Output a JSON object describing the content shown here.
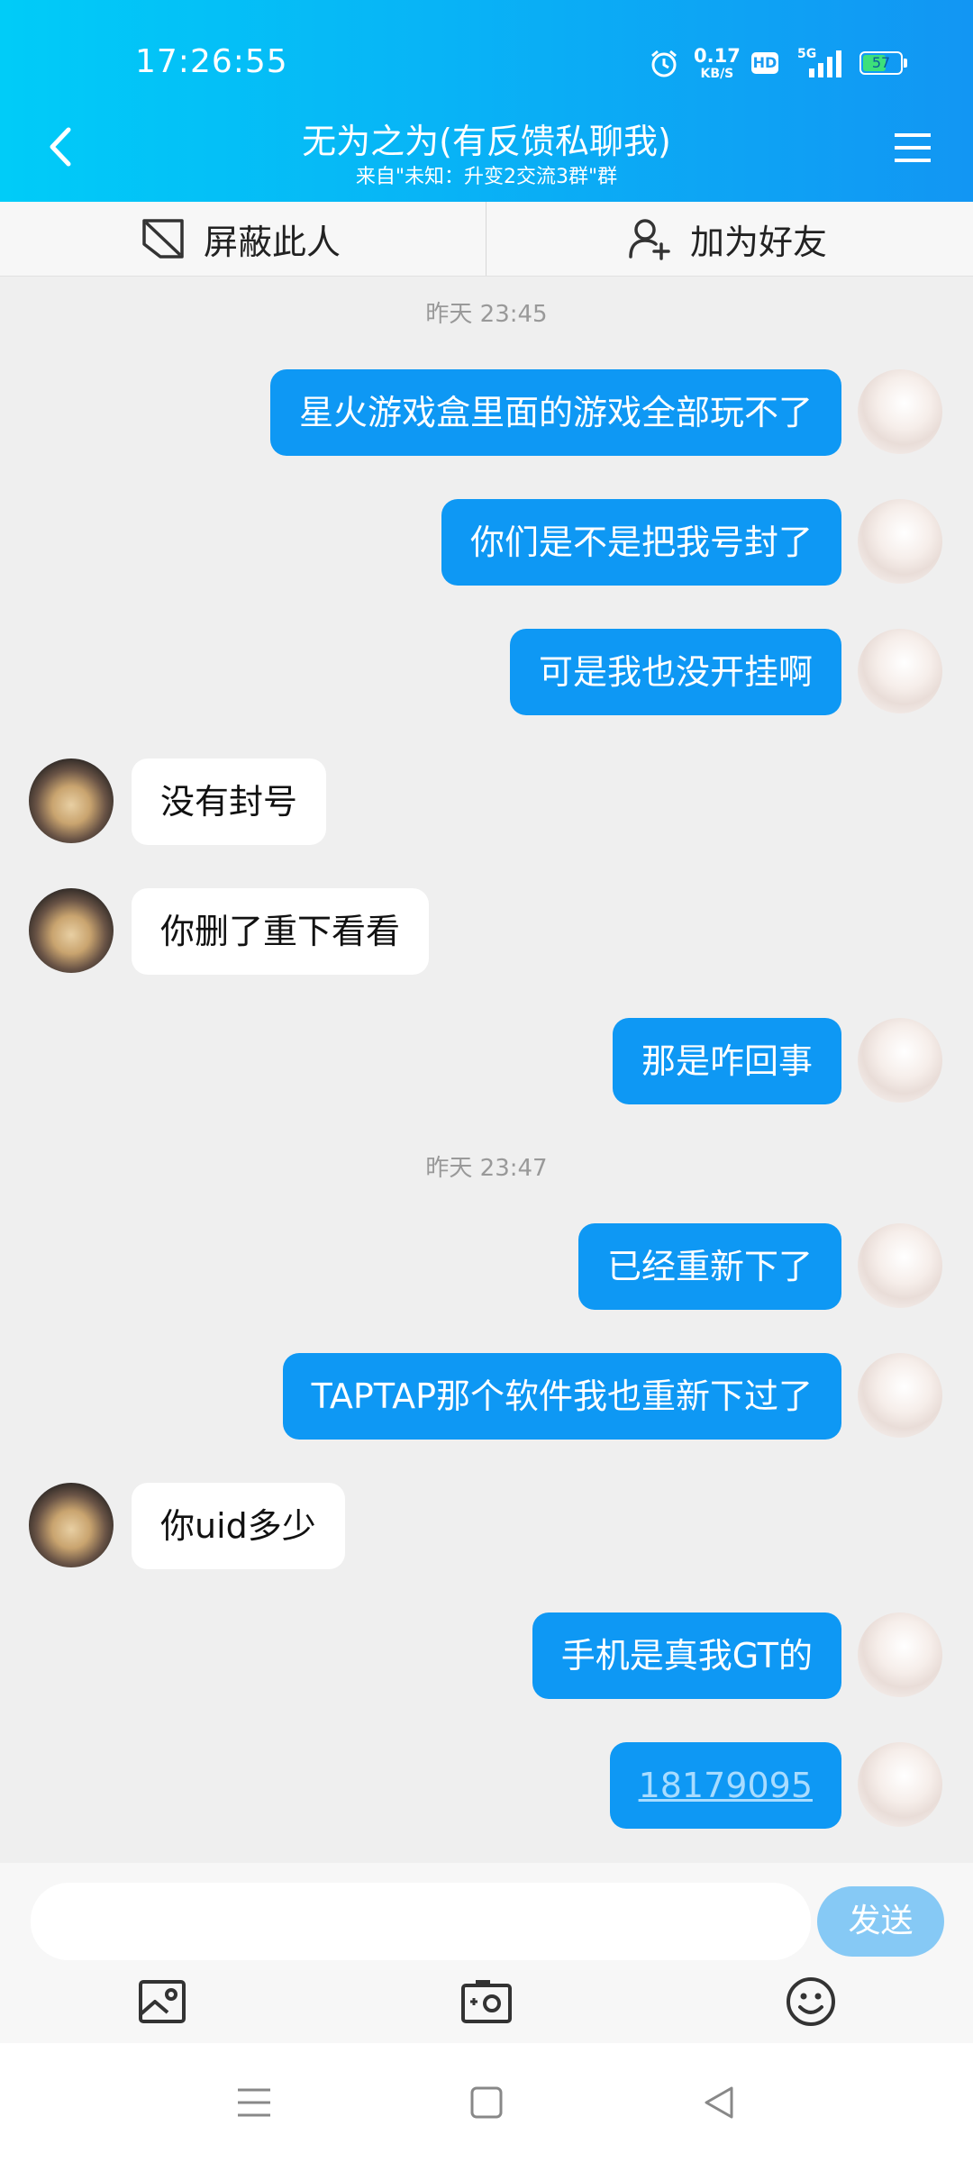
{
  "status_bar": {
    "time": "17:26:55",
    "speed_value": "0.17",
    "speed_unit": "KB/S",
    "hd_label": "HD",
    "network_label": "5G",
    "battery": "57",
    "icons": [
      "alarm-icon",
      "signal-icon"
    ]
  },
  "header": {
    "title": "无为之为(有反馈私聊我)",
    "subtitle": "来自\"未知：升变2交流3群\"群",
    "back_icon": "chevron-left-icon",
    "menu_icon": "menu-icon"
  },
  "actions": {
    "block_label": "屏蔽此人",
    "add_friend_label": "加为好友"
  },
  "messages": [
    {
      "type": "time",
      "text": "昨天 23:45"
    },
    {
      "from": "me",
      "text": "星火游戏盒里面的游戏全部玩不了"
    },
    {
      "from": "me",
      "text": "你们是不是把我号封了"
    },
    {
      "from": "me",
      "text": "可是我也没开挂啊"
    },
    {
      "from": "them",
      "text": "没有封号"
    },
    {
      "from": "them",
      "text": "你删了重下看看"
    },
    {
      "from": "me",
      "text": "那是咋回事"
    },
    {
      "type": "time",
      "text": "昨天 23:47"
    },
    {
      "from": "me",
      "text": "已经重新下了"
    },
    {
      "from": "me",
      "text": "TAPTAP那个软件我也重新下过了"
    },
    {
      "from": "them",
      "text": "你uid多少"
    },
    {
      "from": "me",
      "text": "手机是真我GT的"
    },
    {
      "from": "me",
      "text": "18179095",
      "link": true
    }
  ],
  "composer": {
    "input_value": "",
    "send_label": "发送",
    "tools": [
      "image-icon",
      "camera-icon",
      "emoji-icon"
    ]
  },
  "nav": [
    "recents-icon",
    "home-icon",
    "back-icon"
  ],
  "colors": {
    "header_start": "#00ccf8",
    "header_end": "#1296f3",
    "my_bubble": "#0e98f4",
    "send_button": "#86c9f5"
  }
}
